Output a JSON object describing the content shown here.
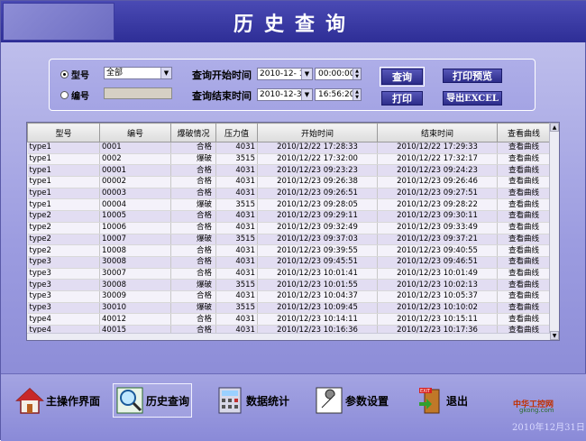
{
  "title": "历史查询",
  "query": {
    "radio_model_label": "型号",
    "radio_number_label": "编号",
    "model_select_value": "全部",
    "start_label": "查询开始时间",
    "end_label": "查询结束时间",
    "start_date": "2010-12- 1",
    "start_time": "00:00:00",
    "end_date": "2010-12-31",
    "end_time": "16:56:20",
    "query_button": "查询",
    "print_button": "打印",
    "preview_button": "打印预览",
    "export_button": "导出EXCEL"
  },
  "table": {
    "columns": [
      "型号",
      "编号",
      "爆破情况",
      "压力值",
      "开始时间",
      "结束时间",
      "查看曲线"
    ],
    "rows": [
      [
        "type1",
        "0001",
        "合格",
        "4031",
        "2010/12/22 17:28:33",
        "2010/12/22 17:29:33",
        "查看曲线"
      ],
      [
        "type1",
        "0002",
        "爆破",
        "3515",
        "2010/12/22 17:32:00",
        "2010/12/22 17:32:17",
        "查看曲线"
      ],
      [
        "type1",
        "00001",
        "合格",
        "4031",
        "2010/12/23 09:23:23",
        "2010/12/23 09:24:23",
        "查看曲线"
      ],
      [
        "type1",
        "00002",
        "合格",
        "4031",
        "2010/12/23 09:26:38",
        "2010/12/23 09:26:46",
        "查看曲线"
      ],
      [
        "type1",
        "00003",
        "合格",
        "4031",
        "2010/12/23 09:26:51",
        "2010/12/23 09:27:51",
        "查看曲线"
      ],
      [
        "type1",
        "00004",
        "爆破",
        "3515",
        "2010/12/23 09:28:05",
        "2010/12/23 09:28:22",
        "查看曲线"
      ],
      [
        "type2",
        "10005",
        "合格",
        "4031",
        "2010/12/23 09:29:11",
        "2010/12/23 09:30:11",
        "查看曲线"
      ],
      [
        "type2",
        "10006",
        "合格",
        "4031",
        "2010/12/23 09:32:49",
        "2010/12/23 09:33:49",
        "查看曲线"
      ],
      [
        "type2",
        "10007",
        "爆破",
        "3515",
        "2010/12/23 09:37:03",
        "2010/12/23 09:37:21",
        "查看曲线"
      ],
      [
        "type2",
        "10008",
        "合格",
        "4031",
        "2010/12/23 09:39:55",
        "2010/12/23 09:40:55",
        "查看曲线"
      ],
      [
        "type3",
        "30008",
        "合格",
        "4031",
        "2010/12/23 09:45:51",
        "2010/12/23 09:46:51",
        "查看曲线"
      ],
      [
        "type3",
        "30007",
        "合格",
        "4031",
        "2010/12/23 10:01:41",
        "2010/12/23 10:01:49",
        "查看曲线"
      ],
      [
        "type3",
        "30008",
        "爆破",
        "3515",
        "2010/12/23 10:01:55",
        "2010/12/23 10:02:13",
        "查看曲线"
      ],
      [
        "type3",
        "30009",
        "合格",
        "4031",
        "2010/12/23 10:04:37",
        "2010/12/23 10:05:37",
        "查看曲线"
      ],
      [
        "type3",
        "30010",
        "爆破",
        "3515",
        "2010/12/23 10:09:45",
        "2010/12/23 10:10:02",
        "查看曲线"
      ],
      [
        "type4",
        "40012",
        "合格",
        "4031",
        "2010/12/23 10:14:11",
        "2010/12/23 10:15:11",
        "查看曲线"
      ],
      [
        "type4",
        "40015",
        "合格",
        "4031",
        "2010/12/23 10:16:36",
        "2010/12/23 10:17:36",
        "查看曲线"
      ]
    ]
  },
  "nav": {
    "home": "主操作界面",
    "history": "历史查询",
    "stats": "数据统计",
    "params": "参数设置",
    "exit": "退出"
  },
  "footer": {
    "watermark": "中华工控网",
    "watermark_url": "gkong.com",
    "date_stamp": "2010年12月31日"
  },
  "icons": {
    "home": "house-icon",
    "history": "magnifier-icon",
    "stats": "calculator-icon",
    "params": "wrench-icon",
    "exit": "exit-door-icon"
  }
}
